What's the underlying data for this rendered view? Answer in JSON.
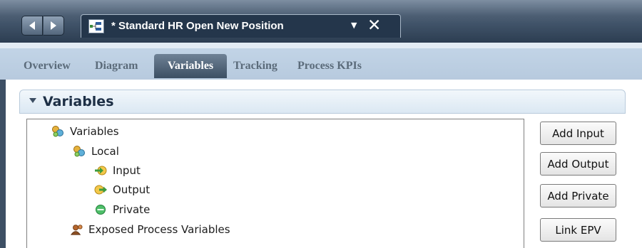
{
  "editor": {
    "tab_title": "* Standard HR Open New Position"
  },
  "tabs": [
    {
      "label": "Overview",
      "active": false
    },
    {
      "label": "Diagram",
      "active": false
    },
    {
      "label": "Variables",
      "active": true
    },
    {
      "label": "Tracking",
      "active": false
    },
    {
      "label": "Process KPIs",
      "active": false
    }
  ],
  "section": {
    "title": "Variables",
    "expanded": true
  },
  "tree": {
    "root": {
      "label": "Variables",
      "icon": "variables-icon"
    },
    "local": {
      "label": "Local",
      "icon": "variables-icon"
    },
    "input": {
      "label": "Input",
      "icon": "input-arrow-icon"
    },
    "output": {
      "label": "Output",
      "icon": "output-arrow-icon"
    },
    "private": {
      "label": "Private",
      "icon": "private-circle-icon"
    },
    "epv": {
      "label": "Exposed Process Variables",
      "icon": "exposed-variables-icon"
    }
  },
  "buttons": {
    "add_input": "Add Input",
    "add_output": "Add Output",
    "add_private": "Add Private",
    "link_epv": "Link EPV"
  },
  "colors": {
    "title_bar": "#2e3f53",
    "tab_bar": "#c4d6e8",
    "active_tab": "#3c4f63",
    "section_header": "#dbe8f3"
  }
}
